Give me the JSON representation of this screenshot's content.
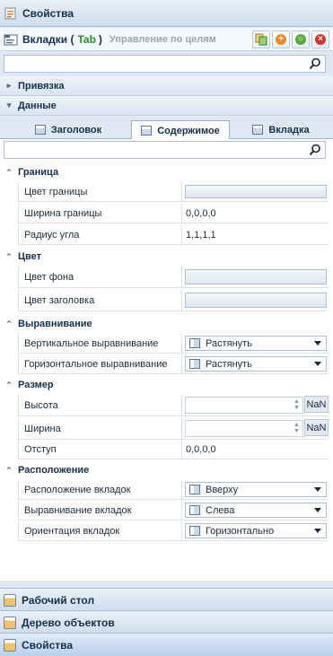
{
  "topbar": {
    "title": "Свойства"
  },
  "component": {
    "name": "Вкладки (",
    "type": "Tab",
    "close_paren": ")",
    "goal_link": "Управление по целям"
  },
  "toolbar": {
    "icons": [
      "copy-icon",
      "add-icon",
      "refresh-icon",
      "delete-icon"
    ]
  },
  "search1": {
    "placeholder": ""
  },
  "sections": {
    "binding": "Привязка",
    "data": "Данные"
  },
  "tabs": [
    {
      "label": "Заголовок",
      "active": false
    },
    {
      "label": "Содержимое",
      "active": true
    },
    {
      "label": "Вкладка",
      "active": false
    }
  ],
  "search2": {
    "placeholder": ""
  },
  "groups": {
    "border": {
      "title": "Граница",
      "rows": [
        {
          "label": "Цвет границы",
          "value": ""
        },
        {
          "label": "Ширина границы",
          "value": "0,0,0,0"
        },
        {
          "label": "Радиус угла",
          "value": "1,1,1,1"
        }
      ]
    },
    "color": {
      "title": "Цвет",
      "rows": [
        {
          "label": "Цвет фона",
          "value": ""
        },
        {
          "label": "Цвет заголовка",
          "value": ""
        }
      ]
    },
    "align": {
      "title": "Выравнивание",
      "rows": [
        {
          "label": "Вертикальное выравнивание",
          "value": "Растянуть"
        },
        {
          "label": "Горизонтальное выравнивание",
          "value": "Растянуть"
        }
      ]
    },
    "size": {
      "title": "Размер",
      "rows": [
        {
          "label": "Высота",
          "value": "",
          "unit": "NaN"
        },
        {
          "label": "Ширина",
          "value": "",
          "unit": "NaN"
        },
        {
          "label": "Отступ",
          "value": "0,0,0,0"
        }
      ]
    },
    "placement": {
      "title": "Расположение",
      "rows": [
        {
          "label": "Расположение вкладок",
          "value": "Вверху"
        },
        {
          "label": "Выравнивание вкладок",
          "value": "Слева"
        },
        {
          "label": "Ориентация вкладок",
          "value": "Горизонтально"
        }
      ]
    }
  },
  "bottom_nav": [
    {
      "label": "Рабочий стол"
    },
    {
      "label": "Дерево объектов"
    },
    {
      "label": "Свойства"
    }
  ],
  "colors": {
    "accent_tab": "#2e8b2e",
    "header_bg": "#dfe8f3"
  }
}
